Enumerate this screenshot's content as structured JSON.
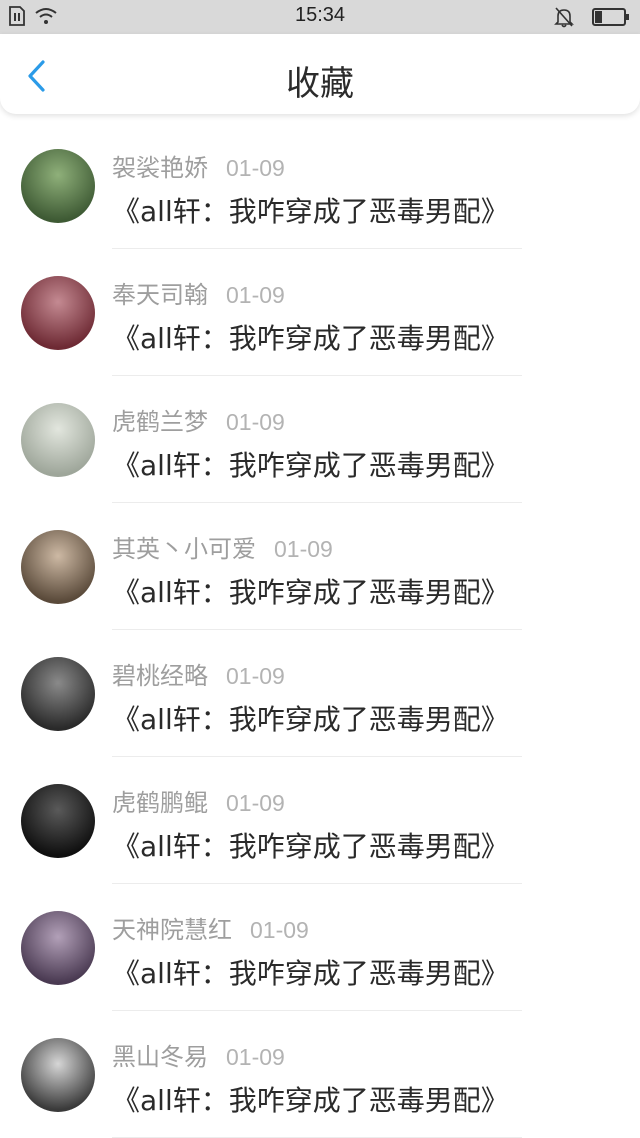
{
  "status_bar": {
    "time": "15:34",
    "icons": [
      "sim-icon",
      "wifi-icon",
      "mute-bell-icon",
      "battery-icon"
    ],
    "battery_level": 0.25
  },
  "header": {
    "title": "收藏",
    "back_icon": "chevron-left-icon",
    "accent_color": "#2b9be8"
  },
  "items": [
    {
      "user": "袈裟艳娇",
      "date": "01-09",
      "title": "《all轩：我咋穿成了恶毒男配》",
      "avatar_colors": [
        "#3e5a34",
        "#8fb07a"
      ]
    },
    {
      "user": "奉天司翰",
      "date": "01-09",
      "title": "《all轩：我咋穿成了恶毒男配》",
      "avatar_colors": [
        "#6e2a34",
        "#c48a92"
      ]
    },
    {
      "user": "虎鹤兰梦",
      "date": "01-09",
      "title": "《all轩：我咋穿成了恶毒男配》",
      "avatar_colors": [
        "#9ea69a",
        "#e2e6de"
      ]
    },
    {
      "user": "其英丶小可爱",
      "date": "01-09",
      "title": "《all轩：我咋穿成了恶毒男配》",
      "avatar_colors": [
        "#5a4a3a",
        "#cdb9a4"
      ]
    },
    {
      "user": "碧桃经略",
      "date": "01-09",
      "title": "《all轩：我咋穿成了恶毒男配》",
      "avatar_colors": [
        "#2a2a2a",
        "#8a8a8a"
      ]
    },
    {
      "user": "虎鹤鹏鲲",
      "date": "01-09",
      "title": "《all轩：我咋穿成了恶毒男配》",
      "avatar_colors": [
        "#0f0f0f",
        "#5a5a5a"
      ]
    },
    {
      "user": "天神院慧红",
      "date": "01-09",
      "title": "《all轩：我咋穿成了恶毒男配》",
      "avatar_colors": [
        "#4a3a52",
        "#b2a0b8"
      ]
    },
    {
      "user": "黑山冬易",
      "date": "01-09",
      "title": "《all轩：我咋穿成了恶毒男配》",
      "avatar_colors": [
        "#3a3a3a",
        "#d6d6d6"
      ]
    }
  ]
}
